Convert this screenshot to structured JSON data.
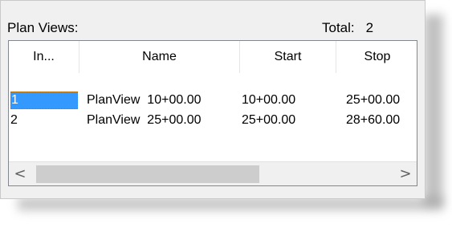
{
  "header": {
    "label": "Plan Views:",
    "total_label": "Total:",
    "total_value": "2"
  },
  "table": {
    "columns": [
      "In...",
      "Name",
      "Start",
      "Stop"
    ],
    "rows": [
      {
        "index": "1",
        "name": "PlanView  10+00.00",
        "start": "10+00.00",
        "stop": "25+00.00",
        "selected": true
      },
      {
        "index": "2",
        "name": "PlanView  25+00.00",
        "start": "25+00.00",
        "stop": "28+60.00",
        "selected": false
      }
    ]
  },
  "scrollbar": {
    "left_arrow": "<",
    "right_arrow": ">",
    "position_fraction": 0.0
  },
  "colors": {
    "selection": "#3399ff",
    "panel_bg": "#f0f0f0"
  }
}
